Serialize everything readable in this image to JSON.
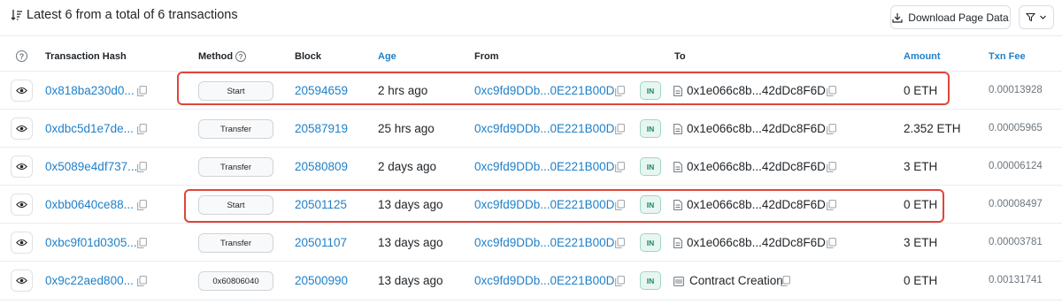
{
  "summary": "Latest 6 from a total of 6 transactions",
  "download_label": "Download Page Data",
  "headers": {
    "hash": "Transaction Hash",
    "method": "Method",
    "block": "Block",
    "age": "Age",
    "from": "From",
    "to": "To",
    "amount": "Amount",
    "fee": "Txn Fee"
  },
  "rows": [
    {
      "hash": "0x818ba230d0...",
      "method": "Start",
      "block": "20594659",
      "age": "2 hrs ago",
      "from": "0xc9fd9DDb...0E221B00D",
      "dir": "IN",
      "to": "0x1e066c8b...42dDc8F6D",
      "amount": "0 ETH",
      "fee": "0.00013928"
    },
    {
      "hash": "0xdbc5d1e7de...",
      "method": "Transfer",
      "block": "20587919",
      "age": "25 hrs ago",
      "from": "0xc9fd9DDb...0E221B00D",
      "dir": "IN",
      "to": "0x1e066c8b...42dDc8F6D",
      "amount": "2.352 ETH",
      "fee": "0.00005965"
    },
    {
      "hash": "0x5089e4df737...",
      "method": "Transfer",
      "block": "20580809",
      "age": "2 days ago",
      "from": "0xc9fd9DDb...0E221B00D",
      "dir": "IN",
      "to": "0x1e066c8b...42dDc8F6D",
      "amount": "3 ETH",
      "fee": "0.00006124"
    },
    {
      "hash": "0xbb0640ce88...",
      "method": "Start",
      "block": "20501125",
      "age": "13 days ago",
      "from": "0xc9fd9DDb...0E221B00D",
      "dir": "IN",
      "to": "0x1e066c8b...42dDc8F6D",
      "amount": "0 ETH",
      "fee": "0.00008497"
    },
    {
      "hash": "0xbc9f01d0305...",
      "method": "Transfer",
      "block": "20501107",
      "age": "13 days ago",
      "from": "0xc9fd9DDb...0E221B00D",
      "dir": "IN",
      "to": "0x1e066c8b...42dDc8F6D",
      "amount": "3 ETH",
      "fee": "0.00003781"
    },
    {
      "hash": "0x9c22aed800...",
      "method": "0x60806040",
      "block": "20500990",
      "age": "13 days ago",
      "from": "0xc9fd9DDb...0E221B00D",
      "dir": "IN",
      "to": "Contract Creation",
      "amount": "0 ETH",
      "fee": "0.00131741"
    }
  ]
}
